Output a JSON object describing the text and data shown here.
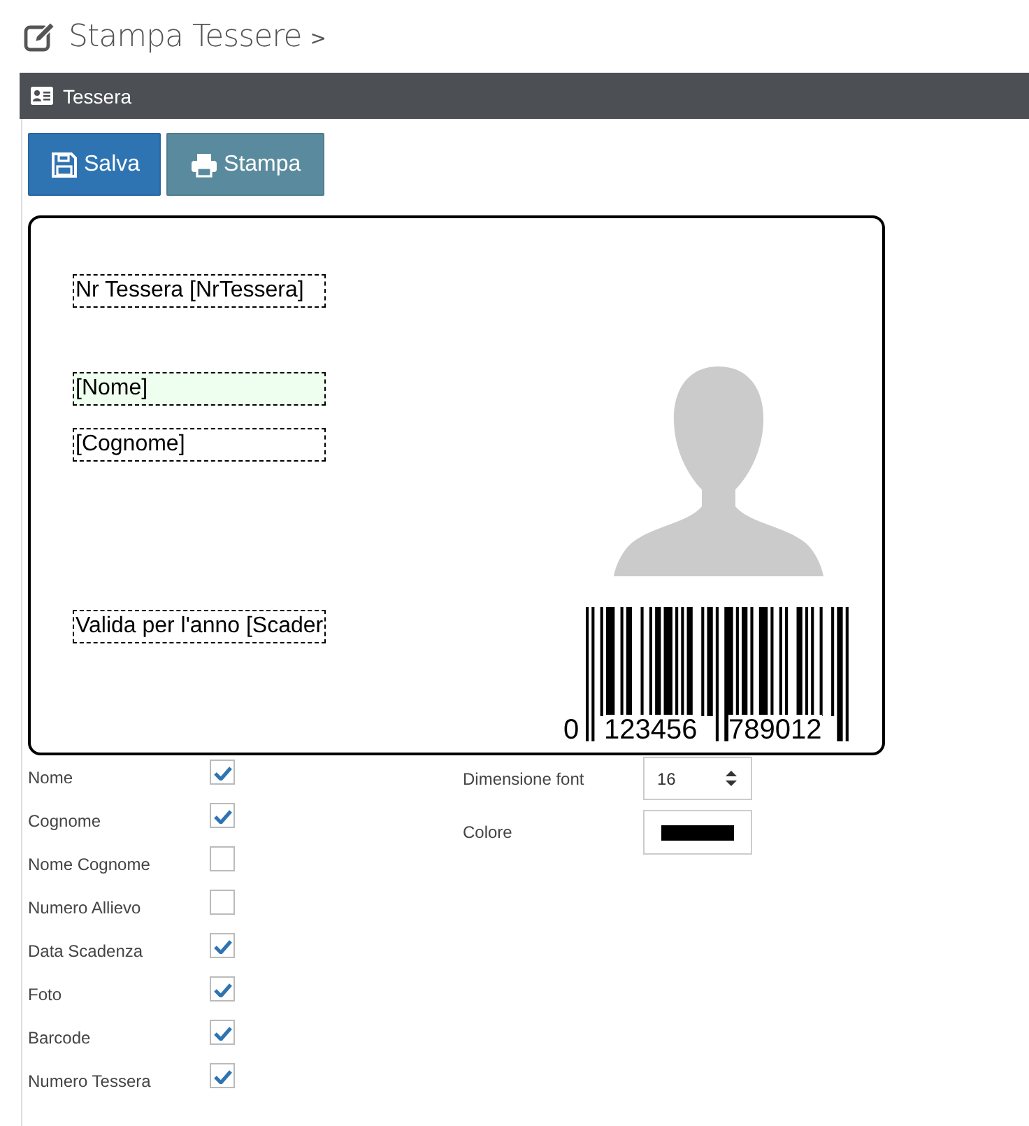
{
  "page_title": "Stampa Tessere",
  "breadcrumb_separator": ">",
  "panel": {
    "title": "Tessera"
  },
  "buttons": [
    {
      "label": "Salva",
      "kind": "save"
    },
    {
      "label": "Stampa",
      "kind": "print"
    }
  ],
  "card": {
    "fields": [
      {
        "text": "Nr Tessera [NrTessera]",
        "highlighted": false
      },
      {
        "text": "[Nome]",
        "highlighted": true
      },
      {
        "text": "[Cognome]",
        "highlighted": false
      },
      {
        "text": "Valida per l'anno [Scader",
        "highlighted": false
      }
    ],
    "barcode": {
      "digits": [
        "0",
        "123456",
        "789012"
      ]
    }
  },
  "options": [
    {
      "label": "Nome",
      "checked": true
    },
    {
      "label": "Cognome",
      "checked": true
    },
    {
      "label": "Nome Cognome",
      "checked": false
    },
    {
      "label": "Numero Allievo",
      "checked": false
    },
    {
      "label": "Data Scadenza",
      "checked": true
    },
    {
      "label": "Foto",
      "checked": true
    },
    {
      "label": "Barcode",
      "checked": true
    },
    {
      "label": "Numero Tessera",
      "checked": true
    }
  ],
  "settings": {
    "font_size": {
      "label": "Dimensione font",
      "value": "16"
    },
    "color": {
      "label": "Colore",
      "color": "#000000"
    }
  }
}
